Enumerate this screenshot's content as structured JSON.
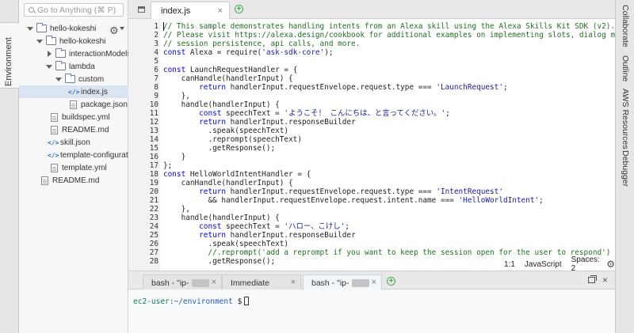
{
  "left_rail": {
    "tab_label": "Environment"
  },
  "search": {
    "placeholder": "Go to Anything (⌘ P)"
  },
  "file_tree": {
    "settings_icon": "gear-icon",
    "items": [
      {
        "label": "hello-kokeshi",
        "type": "folder",
        "expanded": true
      },
      {
        "label": "hello-kokeshi",
        "type": "folder",
        "expanded": true
      },
      {
        "label": "interactionModels",
        "type": "folder",
        "expanded": false
      },
      {
        "label": "lambda",
        "type": "folder",
        "expanded": true
      },
      {
        "label": "custom",
        "type": "folder",
        "expanded": true
      },
      {
        "label": "index.js",
        "type": "code",
        "selected": true
      },
      {
        "label": "package.json",
        "type": "file"
      },
      {
        "label": "buildspec.yml",
        "type": "file"
      },
      {
        "label": "README.md",
        "type": "file"
      },
      {
        "label": "skill.json",
        "type": "code"
      },
      {
        "label": "template-configuration",
        "type": "code"
      },
      {
        "label": "template.yml",
        "type": "file"
      },
      {
        "label": "README.md",
        "type": "file"
      }
    ]
  },
  "editor": {
    "active_tab": "index.js",
    "tab_close": "×",
    "tab_add": "+",
    "lines": [
      {
        "n": "1",
        "text": "// This sample demonstrates handling intents from an Alexa skill using the Alexa Skills Kit SDK (v2)."
      },
      {
        "n": "2",
        "text": "// Please visit https://alexa.design/cookbook for additional examples on implementing slots, dialog management,"
      },
      {
        "n": "3",
        "text": "// session persistence, api calls, and more."
      },
      {
        "n": "4",
        "text": "const Alexa = require('ask-sdk-core');"
      },
      {
        "n": "5",
        "text": ""
      },
      {
        "n": "6",
        "text": "const LaunchRequestHandler = {"
      },
      {
        "n": "7",
        "text": "    canHandle(handlerInput) {"
      },
      {
        "n": "8",
        "text": "        return handlerInput.requestEnvelope.request.type === 'LaunchRequest';"
      },
      {
        "n": "9",
        "text": "    },"
      },
      {
        "n": "10",
        "text": "    handle(handlerInput) {"
      },
      {
        "n": "11",
        "text": "        const speechText = 'ようこそ！ こんにちは、と言ってください。';"
      },
      {
        "n": "12",
        "text": "        return handlerInput.responseBuilder"
      },
      {
        "n": "13",
        "text": "          .speak(speechText)"
      },
      {
        "n": "14",
        "text": "          .reprompt(speechText)"
      },
      {
        "n": "15",
        "text": "          .getResponse();"
      },
      {
        "n": "16",
        "text": "    }"
      },
      {
        "n": "17",
        "text": "};"
      },
      {
        "n": "18",
        "text": "const HelloWorldIntentHandler = {"
      },
      {
        "n": "19",
        "text": "    canHandle(handlerInput) {"
      },
      {
        "n": "20",
        "text": "        return handlerInput.requestEnvelope.request.type === 'IntentRequest'"
      },
      {
        "n": "21",
        "text": "          && handlerInput.requestEnvelope.request.intent.name === 'HelloWorldIntent';"
      },
      {
        "n": "22",
        "text": "    },"
      },
      {
        "n": "23",
        "text": "    handle(handlerInput) {"
      },
      {
        "n": "24",
        "text": "        const speechText = 'ハロー、こけし';"
      },
      {
        "n": "25",
        "text": "        return handlerInput.responseBuilder"
      },
      {
        "n": "26",
        "text": "          .speak(speechText)"
      },
      {
        "n": "27",
        "text": "          //.reprompt('add a reprompt if you want to keep the session open for the user to respond')"
      },
      {
        "n": "28",
        "text": "          .getResponse();"
      }
    ],
    "status": {
      "position": "1:1",
      "language": "JavaScript",
      "spaces": "Spaces: 2"
    }
  },
  "terminal": {
    "tabs": [
      {
        "label": "bash - \"ip-",
        "active": false
      },
      {
        "label": "Immediate",
        "active": false
      },
      {
        "label": "bash - \"ip-",
        "active": true
      }
    ],
    "close_glyph": "×",
    "prompt_user": "ec2-user",
    "prompt_path": ":~/environment",
    "prompt_symbol": " $"
  },
  "right_rail": {
    "tabs": [
      "Collaborate",
      "Outline",
      "AWS Resources",
      "Debugger"
    ]
  },
  "colors": {
    "comment": "#236e25",
    "string": "#1a1aa6",
    "accent_green": "#3fae49",
    "selection": "#dbe5f1"
  }
}
